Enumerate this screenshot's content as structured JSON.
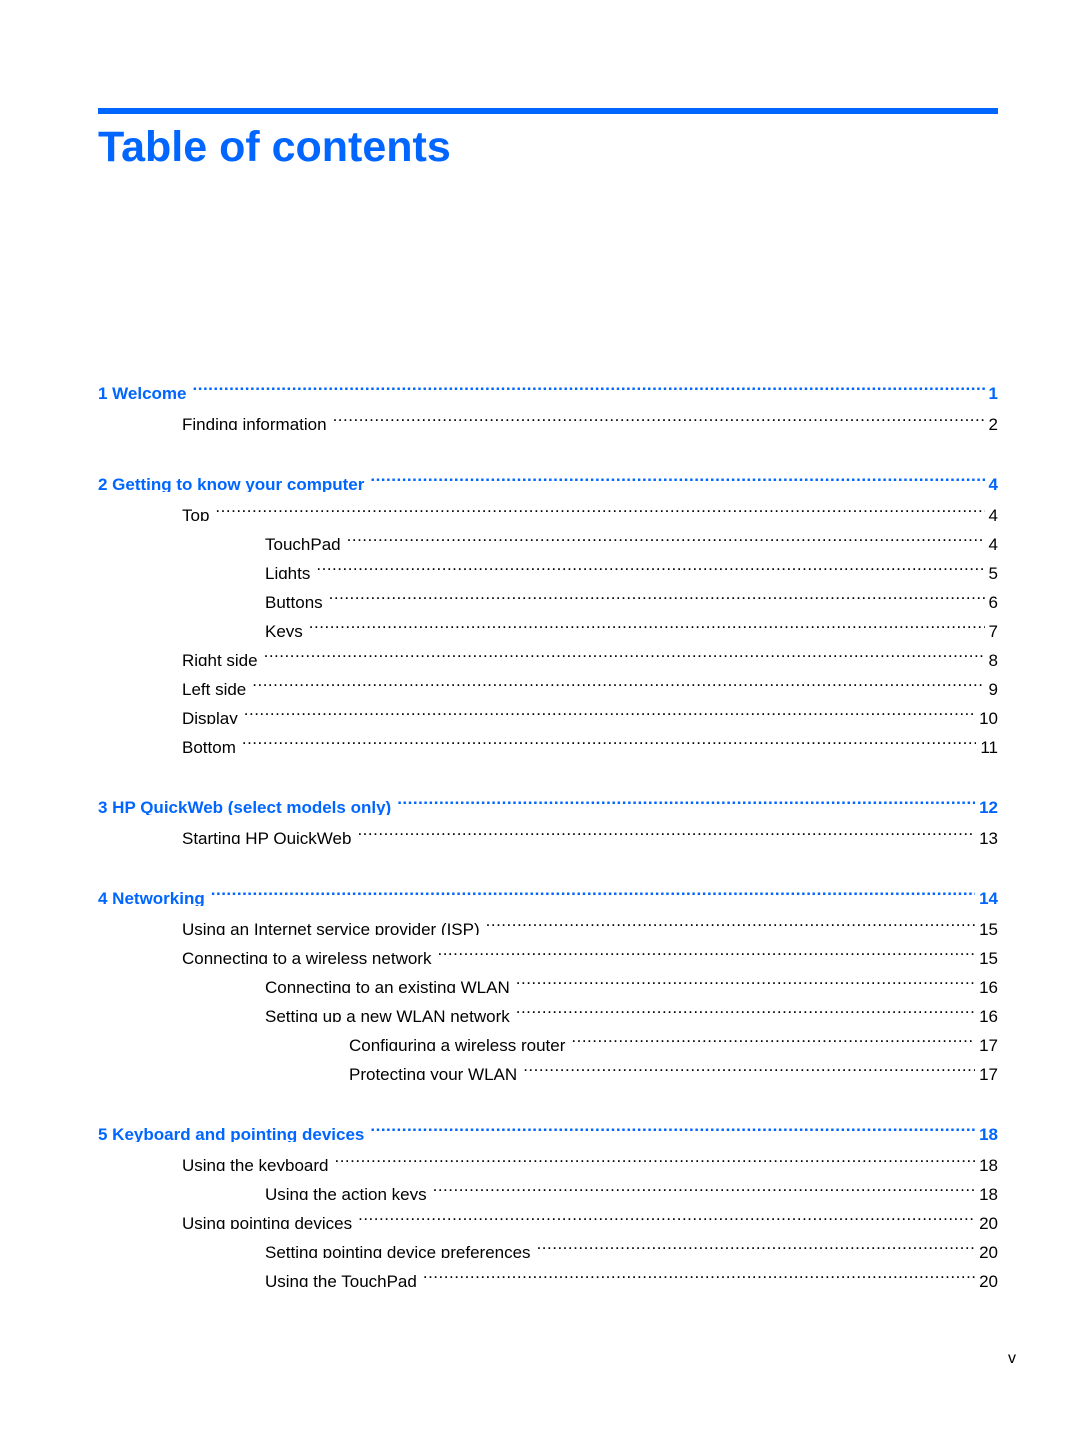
{
  "document": {
    "title": "Table of contents",
    "page_number": "v",
    "accent_color": "#0066ff",
    "chapters": [
      {
        "label": "1  Welcome",
        "page": "1",
        "entries": [
          {
            "level": 1,
            "label": "Finding information",
            "page": "2"
          }
        ]
      },
      {
        "label": "2  Getting to know your computer",
        "page": "4",
        "entries": [
          {
            "level": 1,
            "label": "Top",
            "page": "4"
          },
          {
            "level": 2,
            "label": "TouchPad",
            "page": "4"
          },
          {
            "level": 2,
            "label": "Lights",
            "page": "5"
          },
          {
            "level": 2,
            "label": "Buttons",
            "page": "6"
          },
          {
            "level": 2,
            "label": "Keys",
            "page": "7"
          },
          {
            "level": 1,
            "label": "Right side",
            "page": "8"
          },
          {
            "level": 1,
            "label": "Left side",
            "page": "9"
          },
          {
            "level": 1,
            "label": "Display",
            "page": "10"
          },
          {
            "level": 1,
            "label": "Bottom",
            "page": "11"
          }
        ]
      },
      {
        "label": "3  HP QuickWeb (select models only)",
        "page": "12",
        "entries": [
          {
            "level": 1,
            "label": "Starting HP QuickWeb",
            "page": "13"
          }
        ]
      },
      {
        "label": "4  Networking",
        "page": "14",
        "entries": [
          {
            "level": 1,
            "label": "Using an Internet service provider (ISP)",
            "page": "15"
          },
          {
            "level": 1,
            "label": "Connecting to a wireless network",
            "page": "15"
          },
          {
            "level": 2,
            "label": "Connecting to an existing WLAN",
            "page": "16"
          },
          {
            "level": 2,
            "label": "Setting up a new WLAN network",
            "page": "16"
          },
          {
            "level": 3,
            "label": "Configuring a wireless router",
            "page": "17"
          },
          {
            "level": 3,
            "label": "Protecting your WLAN",
            "page": "17"
          }
        ]
      },
      {
        "label": "5  Keyboard and pointing devices",
        "page": "18",
        "entries": [
          {
            "level": 1,
            "label": "Using the keyboard",
            "page": "18"
          },
          {
            "level": 2,
            "label": "Using the action keys",
            "page": "18"
          },
          {
            "level": 1,
            "label": "Using pointing devices",
            "page": "20"
          },
          {
            "level": 2,
            "label": "Setting pointing device preferences",
            "page": "20"
          },
          {
            "level": 2,
            "label": "Using the TouchPad",
            "page": "20"
          }
        ]
      }
    ]
  }
}
